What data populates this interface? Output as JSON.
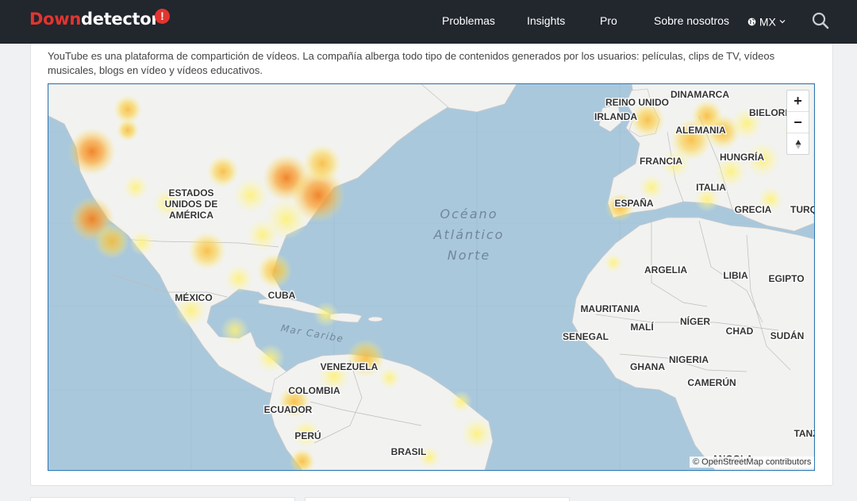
{
  "header": {
    "logo_down": "Down",
    "logo_detector": "detector",
    "logo_mark": "!",
    "nav": [
      {
        "label": "Problemas"
      },
      {
        "label": "Insights"
      },
      {
        "label": "Pro"
      },
      {
        "label": "Sobre nosotros"
      }
    ],
    "region": "MX",
    "icons": {
      "region": "globe-icon",
      "region_caret": "chevron-down-icon",
      "search": "search-icon"
    }
  },
  "description": "YouTube es una plataforma de compartición de vídeos. La compañía alberga todo tipo de contenidos generados por los usuarios: películas, clips de TV, vídeos musicales, blogs en vídeo y vídeos educativos.",
  "map": {
    "labels": {
      "estados_unidos": [
        "ESTADOS",
        "UNIDOS DE",
        "AMÉRICA"
      ],
      "mexico": "MÉXICO",
      "cuba": "CUBA",
      "venezuela": "VENEZUELA",
      "colombia": "COLOMBIA",
      "ecuador": "ECUADOR",
      "peru": "PERÚ",
      "brasil": "BRASIL",
      "mar_caribe": "Mar Caribe",
      "oceano": [
        "Océano",
        "Atlántico",
        "Norte"
      ],
      "reino_unido": "REINO UNIDO",
      "irlanda": "IRLANDA",
      "dinamarca": "DINAMARCA",
      "bielorr": "BIELORR",
      "alemania": "ALEMANIA",
      "francia": "FRANCIA",
      "hungria": "HUNGRÍA",
      "italia": "ITALIA",
      "espana": "ESPAÑA",
      "grecia": "GRECIA",
      "turq": "TURQ",
      "argelia": "ARGELIA",
      "libia": "LIBIA",
      "egipto": "EGIPTO",
      "mauritania": "MAURITANIA",
      "mali": "MALÍ",
      "niger": "NÍGER",
      "chad": "CHAD",
      "sudan": "SUDÁN",
      "senegal": "SENEGAL",
      "ghana": "GHANA",
      "nigeria": "NIGERIA",
      "camerun": "CAMERÚN",
      "angola": "ANGOLA",
      "tanz": "TANZ"
    },
    "controls": {
      "zoom_in": "+",
      "zoom_out": "−",
      "reset_north": "▲"
    },
    "attribution": "© OpenStreetMap contributors",
    "colors": {
      "ocean": "#aac8dc",
      "land": "#f2f2f0",
      "hot": "#f07f22",
      "warm": "#f9c23c",
      "mild": "#fff06e"
    }
  }
}
